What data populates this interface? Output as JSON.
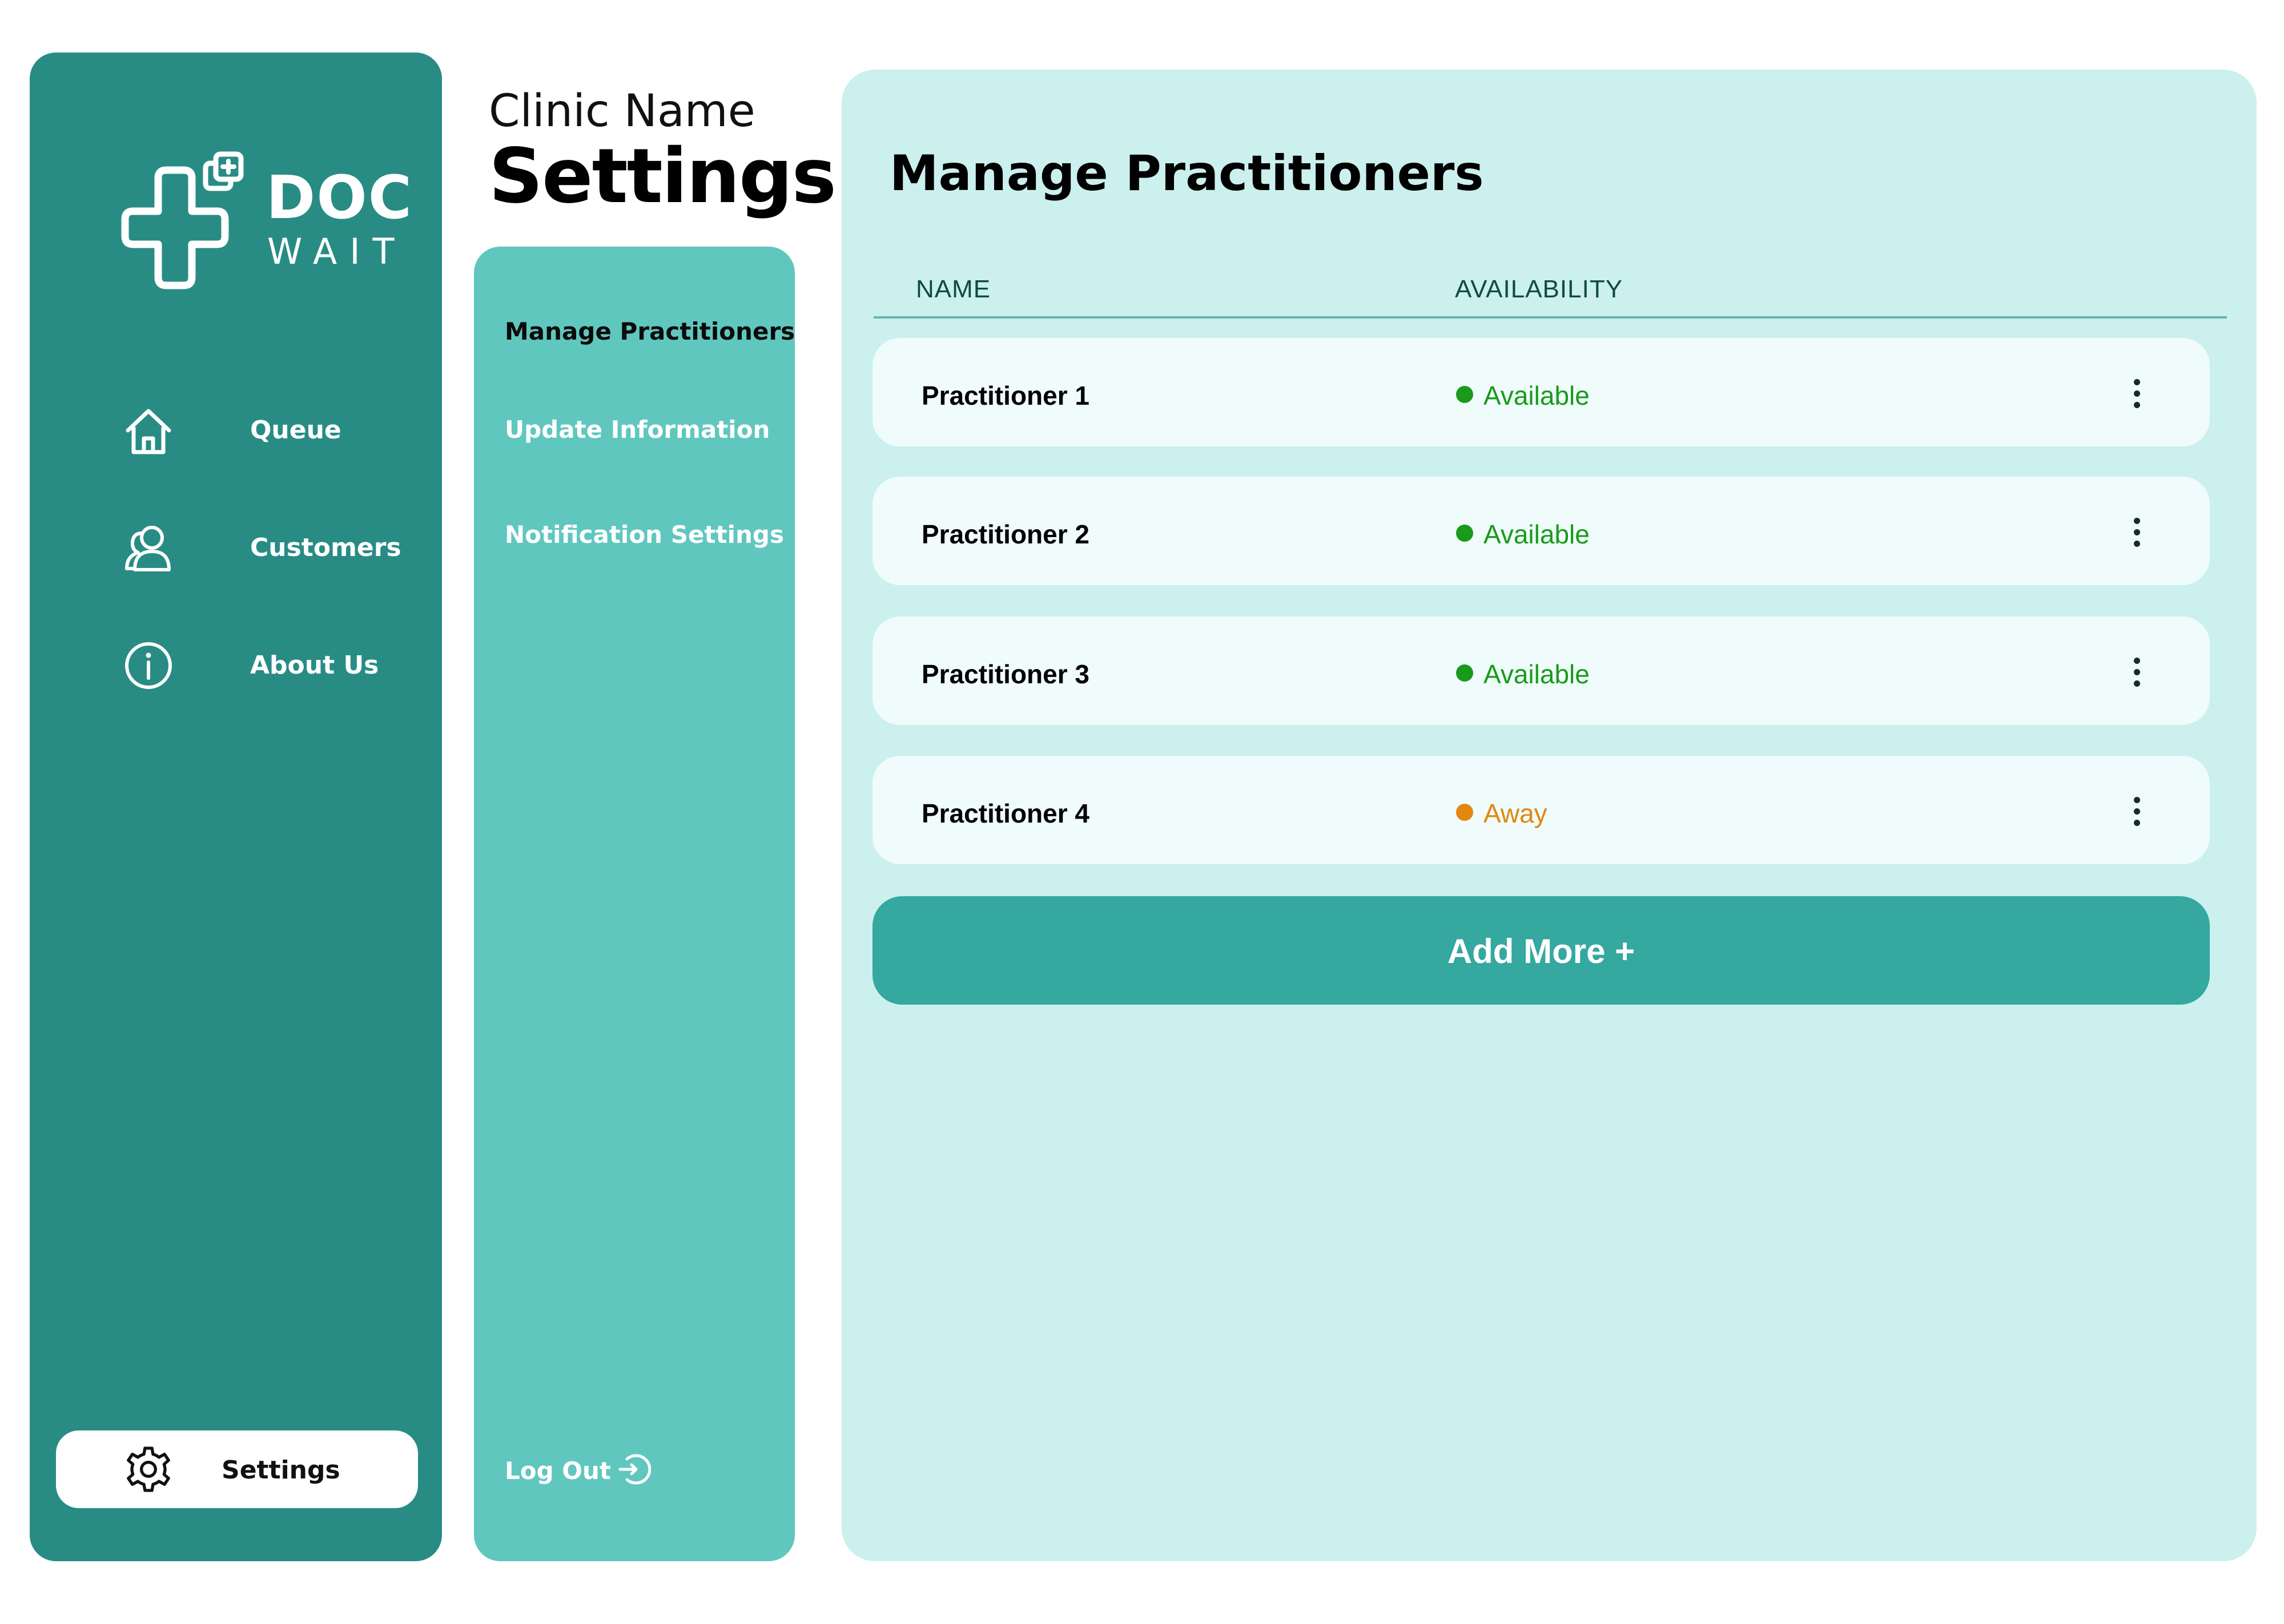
{
  "brand": {
    "logo_line1": "DOC",
    "logo_line2": "WAIT"
  },
  "sidebar": {
    "items": [
      {
        "label": "Queue",
        "icon": "home-icon"
      },
      {
        "label": "Customers",
        "icon": "users-icon"
      },
      {
        "label": "About Us",
        "icon": "info-icon"
      }
    ],
    "settings": {
      "label": "Settings",
      "icon": "gear-icon"
    }
  },
  "header": {
    "clinic_name": "Clinic Name",
    "title": "Settings"
  },
  "settings_menu": {
    "items": [
      {
        "label": "Manage Practitioners",
        "active": true
      },
      {
        "label": "Update Information",
        "active": false
      },
      {
        "label": "Notification Settings",
        "active": false
      }
    ],
    "logout": {
      "label": "Log Out",
      "icon": "logout-icon"
    }
  },
  "main": {
    "title": "Manage Practitioners",
    "columns": {
      "name": "NAME",
      "availability": "AVAILABILITY"
    },
    "practitioners": [
      {
        "name": "Practitioner 1",
        "status": "Available",
        "status_color": "#1a9a1a"
      },
      {
        "name": "Practitioner 2",
        "status": "Available",
        "status_color": "#1a9a1a"
      },
      {
        "name": "Practitioner 3",
        "status": "Available",
        "status_color": "#1a9a1a"
      },
      {
        "name": "Practitioner 4",
        "status": "Away",
        "status_color": "#e2870f"
      }
    ],
    "add_button": "Add More +"
  },
  "colors": {
    "sidebar_bg": "#288c85",
    "menu_bg": "#60c7bf",
    "panel_bg": "#cbf0ee",
    "row_bg": "#effcfb",
    "accent_button": "#35a8a0",
    "available": "#1a9a1a",
    "away": "#e2870f"
  }
}
